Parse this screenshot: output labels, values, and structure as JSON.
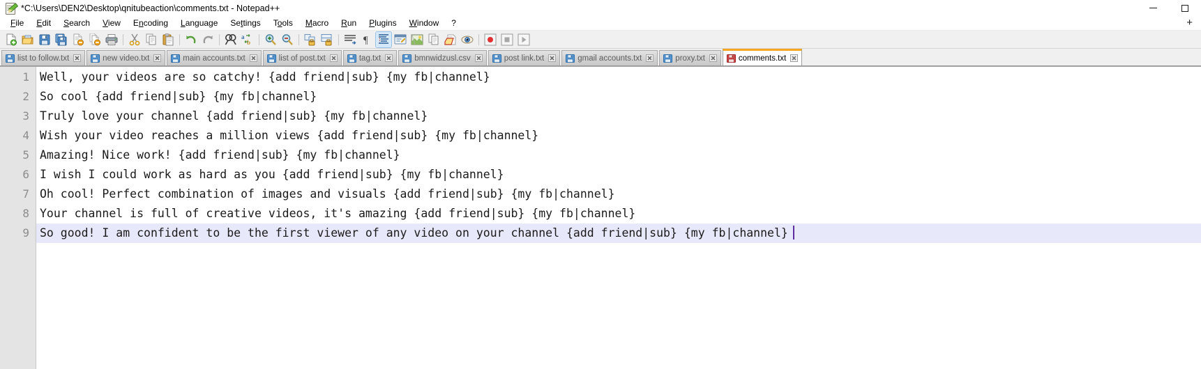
{
  "window": {
    "title": "*C:\\Users\\DEN2\\Desktop\\qnitubeaction\\comments.txt - Notepad++",
    "icon": "notepadpp-document-pencil-icon",
    "minimize_label": "Minimize",
    "maximize_label": "Maximize"
  },
  "menu": {
    "items": [
      {
        "label": "File",
        "mnemonic": "F"
      },
      {
        "label": "Edit",
        "mnemonic": "E"
      },
      {
        "label": "Search",
        "mnemonic": "S"
      },
      {
        "label": "View",
        "mnemonic": "V"
      },
      {
        "label": "Encoding",
        "mnemonic": "n"
      },
      {
        "label": "Language",
        "mnemonic": "L"
      },
      {
        "label": "Settings",
        "mnemonic": "t"
      },
      {
        "label": "Tools",
        "mnemonic": "o"
      },
      {
        "label": "Macro",
        "mnemonic": "M"
      },
      {
        "label": "Run",
        "mnemonic": "R"
      },
      {
        "label": "Plugins",
        "mnemonic": "P"
      },
      {
        "label": "Window",
        "mnemonic": "W"
      },
      {
        "label": "?",
        "mnemonic": ""
      }
    ],
    "plus_label": "+"
  },
  "toolbar": {
    "buttons": [
      {
        "name": "new-file-icon",
        "title": "New"
      },
      {
        "name": "open-file-icon",
        "title": "Open"
      },
      {
        "name": "save-icon",
        "title": "Save"
      },
      {
        "name": "save-all-icon",
        "title": "Save All"
      },
      {
        "name": "close-file-icon",
        "title": "Close"
      },
      {
        "name": "close-all-icon",
        "title": "Close All"
      },
      {
        "name": "print-icon",
        "title": "Print"
      },
      {
        "name": "separator",
        "title": ""
      },
      {
        "name": "cut-icon",
        "title": "Cut"
      },
      {
        "name": "copy-icon",
        "title": "Copy"
      },
      {
        "name": "paste-icon",
        "title": "Paste"
      },
      {
        "name": "separator",
        "title": ""
      },
      {
        "name": "undo-icon",
        "title": "Undo"
      },
      {
        "name": "redo-icon",
        "title": "Redo"
      },
      {
        "name": "separator",
        "title": ""
      },
      {
        "name": "find-icon",
        "title": "Find"
      },
      {
        "name": "replace-icon",
        "title": "Replace"
      },
      {
        "name": "separator",
        "title": ""
      },
      {
        "name": "zoom-in-icon",
        "title": "Zoom In"
      },
      {
        "name": "zoom-out-icon",
        "title": "Zoom Out"
      },
      {
        "name": "separator",
        "title": ""
      },
      {
        "name": "sync-vertical-scroll-icon",
        "title": "Synchronize Vertical Scrolling"
      },
      {
        "name": "sync-horizontal-scroll-icon",
        "title": "Synchronize Horizontal Scrolling"
      },
      {
        "name": "separator",
        "title": ""
      },
      {
        "name": "word-wrap-icon",
        "title": "Word wrap"
      },
      {
        "name": "show-all-characters-icon",
        "title": "Show All Characters"
      },
      {
        "name": "show-indent-guide-icon",
        "title": "Show Indent Guide",
        "active": true
      },
      {
        "name": "user-defined-dialog-icon",
        "title": "User Defined Dialogue"
      },
      {
        "name": "document-map-icon",
        "title": "Document Map"
      },
      {
        "name": "function-list-icon",
        "title": "Function List"
      },
      {
        "name": "folder-workspace-icon",
        "title": "Folder as Workspace"
      },
      {
        "name": "monitoring-eye-icon",
        "title": "Monitoring"
      },
      {
        "name": "separator",
        "title": ""
      },
      {
        "name": "record-macro-icon",
        "title": "Start Recording"
      },
      {
        "name": "stop-macro-icon",
        "title": "Stop Recording"
      },
      {
        "name": "play-macro-icon",
        "title": "Play Macro"
      }
    ]
  },
  "tabs": {
    "items": [
      {
        "label": "list to follow.txt",
        "active": false,
        "modified": false
      },
      {
        "label": "new video.txt",
        "active": false,
        "modified": false
      },
      {
        "label": "main accounts.txt",
        "active": false,
        "modified": false
      },
      {
        "label": "list of post.txt",
        "active": false,
        "modified": false
      },
      {
        "label": "tag.txt",
        "active": false,
        "modified": false
      },
      {
        "label": "bmnwidzusl.csv",
        "active": false,
        "modified": false
      },
      {
        "label": "post link.txt",
        "active": false,
        "modified": false
      },
      {
        "label": "gmail accounts.txt",
        "active": false,
        "modified": false
      },
      {
        "label": "proxy.txt",
        "active": false,
        "modified": false
      },
      {
        "label": "comments.txt",
        "active": true,
        "modified": true
      }
    ],
    "close_icon": "close-tab-icon",
    "file_icon": "floppy-disk-icon"
  },
  "editor": {
    "current_line": 9,
    "lines": [
      {
        "n": "1",
        "text": "Well, your videos are so catchy! {add friend|sub} {my fb|channel}"
      },
      {
        "n": "2",
        "text": "So cool {add friend|sub} {my fb|channel}"
      },
      {
        "n": "3",
        "text": "Truly love your channel {add friend|sub} {my fb|channel}"
      },
      {
        "n": "4",
        "text": "Wish your video reaches a million views {add friend|sub} {my fb|channel}"
      },
      {
        "n": "5",
        "text": "Amazing! Nice work! {add friend|sub} {my fb|channel}"
      },
      {
        "n": "6",
        "text": "I wish I could work as hard as you {add friend|sub} {my fb|channel}"
      },
      {
        "n": "7",
        "text": "Oh cool! Perfect combination of images and visuals {add friend|sub} {my fb|channel}"
      },
      {
        "n": "8",
        "text": "Your channel is full of creative videos, it's amazing {add friend|sub} {my fb|channel}"
      },
      {
        "n": "9",
        "text": "So good! I am confident to be the first viewer of any video on your channel {add friend|sub} {my fb|channel}"
      }
    ]
  },
  "colors": {
    "accent_tab": "#f5a623",
    "current_line": "#e8e8fb",
    "caret": "#5b2fa0",
    "gutter_bg": "#e4e4e4",
    "toolbar_bg": "#f0f0f0"
  }
}
